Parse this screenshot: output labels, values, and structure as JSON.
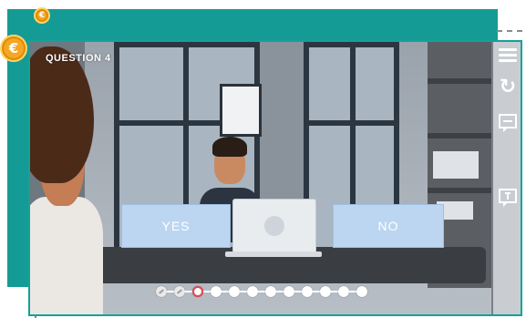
{
  "header": {
    "question_label": "QUESTION 4"
  },
  "answers": {
    "yes_label": "YES",
    "no_label": "NO"
  },
  "toolbar": {
    "menu_icon": "menu-icon",
    "reload_icon": "reload-icon",
    "transcript_icon": "transcript-icon",
    "feedback_icon": "feedback-icon"
  },
  "progress": {
    "total": 12,
    "current": 4,
    "states": [
      "done",
      "done",
      "wrong",
      "todo",
      "todo",
      "todo",
      "todo",
      "todo",
      "todo",
      "todo",
      "todo",
      "todo"
    ]
  },
  "colors": {
    "teal": "#159b95",
    "coin": "#f5a623",
    "answer_box": "#bcd6f2"
  }
}
